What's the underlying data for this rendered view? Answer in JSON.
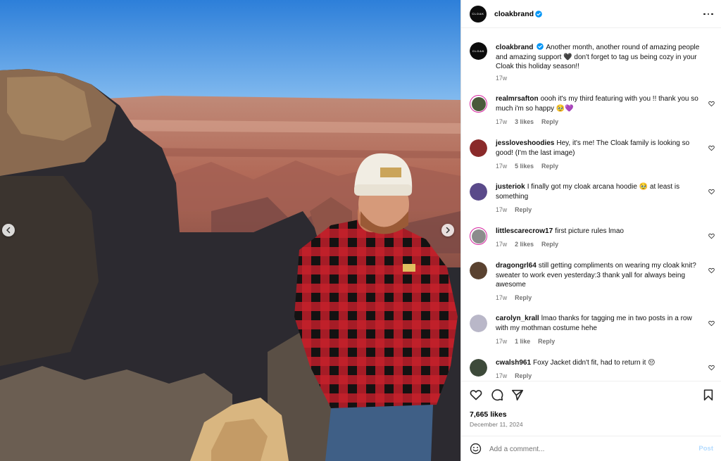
{
  "post": {
    "username": "cloakbrand",
    "avatar_text": "CLOAK",
    "caption": "Another month, another round of amazing people and amazing support 🖤 don't forget to tag us being cozy in your Cloak this holiday season!!",
    "caption_age": "17w",
    "likes": "7,665 likes",
    "date": "December 11, 2024"
  },
  "comments": [
    {
      "user": "realmrsafton",
      "text": "oooh it's my third featuring with you !! thank you so much i'm so happy 🥹💜",
      "age": "17w",
      "likes": "3 likes",
      "reply": "Reply",
      "avatar_color": "#4a5a3a"
    },
    {
      "user": "jessloveshoodies",
      "text": "Hey, it's me! The Cloak family is looking so good! (I'm the last image)",
      "age": "17w",
      "likes": "5 likes",
      "reply": "Reply",
      "avatar_color": "#8a2a2a"
    },
    {
      "user": "justeriok",
      "text": "I finally got my cloak arcana hoodie 🥹 at least is something",
      "age": "17w",
      "likes": "",
      "reply": "Reply",
      "avatar_color": "#5a4a8a"
    },
    {
      "user": "littlescarecrow17",
      "text": "first picture rules lmao",
      "age": "17w",
      "likes": "2 likes",
      "reply": "Reply",
      "avatar_color": "#8c8c8c"
    },
    {
      "user": "dragongrl64",
      "text": "still getting compliments on wearing my cloak knit? sweater to work even yesterday:3 thank yall for always being awesome",
      "age": "17w",
      "likes": "",
      "reply": "Reply",
      "avatar_color": "#5a4230"
    },
    {
      "user": "carolyn_krall",
      "text": "lmao thanks for tagging me in two posts in a row with my mothman costume hehe",
      "age": "17w",
      "likes": "1 like",
      "reply": "Reply",
      "avatar_color": "#b9b7c8"
    },
    {
      "user": "cwalsh961",
      "text": "Foxy Jacket didn't fit, had to return it 😔",
      "age": "17w",
      "likes": "",
      "reply": "Reply",
      "avatar_color": "#3d4a3a"
    }
  ],
  "composer": {
    "placeholder": "Add a comment...",
    "post_label": "Post"
  },
  "icons": {
    "like": "heart-icon",
    "comment": "comment-bubble-icon",
    "share": "paper-plane-icon",
    "save": "bookmark-icon",
    "emoji": "smiley-icon",
    "more": "more-horizontal-icon",
    "verified": "verified-badge-icon",
    "carousel_prev": "chevron-left-icon",
    "carousel_next": "chevron-right-icon"
  },
  "colors": {
    "verified": "#0095f6",
    "post_disabled": "#b3dbff",
    "meta_text": "#737373",
    "story_ring": "#d6249f"
  }
}
